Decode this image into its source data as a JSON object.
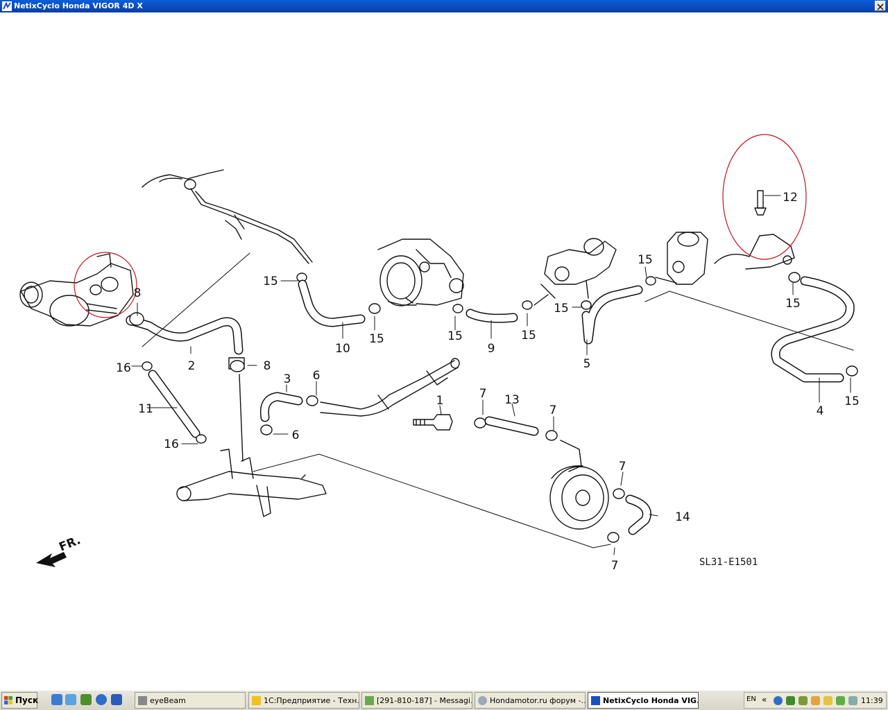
{
  "window": {
    "title": "NetixCyclo Honda VIGOR 4D X"
  },
  "diagram": {
    "ref_code": "SL31-E1501",
    "direction_label": "FR.",
    "callouts": [
      {
        "label": "1"
      },
      {
        "label": "2"
      },
      {
        "label": "3"
      },
      {
        "label": "4"
      },
      {
        "label": "5"
      },
      {
        "label": "6"
      },
      {
        "label": "6"
      },
      {
        "label": "7"
      },
      {
        "label": "7"
      },
      {
        "label": "7"
      },
      {
        "label": "7"
      },
      {
        "label": "8"
      },
      {
        "label": "8"
      },
      {
        "label": "9"
      },
      {
        "label": "10"
      },
      {
        "label": "11"
      },
      {
        "label": "12"
      },
      {
        "label": "13"
      },
      {
        "label": "14"
      },
      {
        "label": "15"
      },
      {
        "label": "15"
      },
      {
        "label": "15"
      },
      {
        "label": "15"
      },
      {
        "label": "15"
      },
      {
        "label": "15"
      },
      {
        "label": "15"
      },
      {
        "label": "15"
      },
      {
        "label": "16"
      },
      {
        "label": "16"
      }
    ],
    "highlight_color": "#c0141e"
  },
  "taskbar": {
    "start_label": "Пуск",
    "tasks": [
      {
        "label": "eyeBeam",
        "icon": "eyebeam-icon",
        "active": false
      },
      {
        "label": "1С:Предприятие - Техн...",
        "icon": "1c-icon",
        "active": false
      },
      {
        "label": "[291-810-187] - Messagi...",
        "icon": "icq-message-icon",
        "active": false
      },
      {
        "label": "Hondamotor.ru форум -...",
        "icon": "browser-icon",
        "active": false
      },
      {
        "label": "NetixCyclo Honda VIG...",
        "icon": "netixcyclo-icon",
        "active": true
      }
    ],
    "tray": {
      "language": "EN",
      "clock": "11:39"
    }
  }
}
